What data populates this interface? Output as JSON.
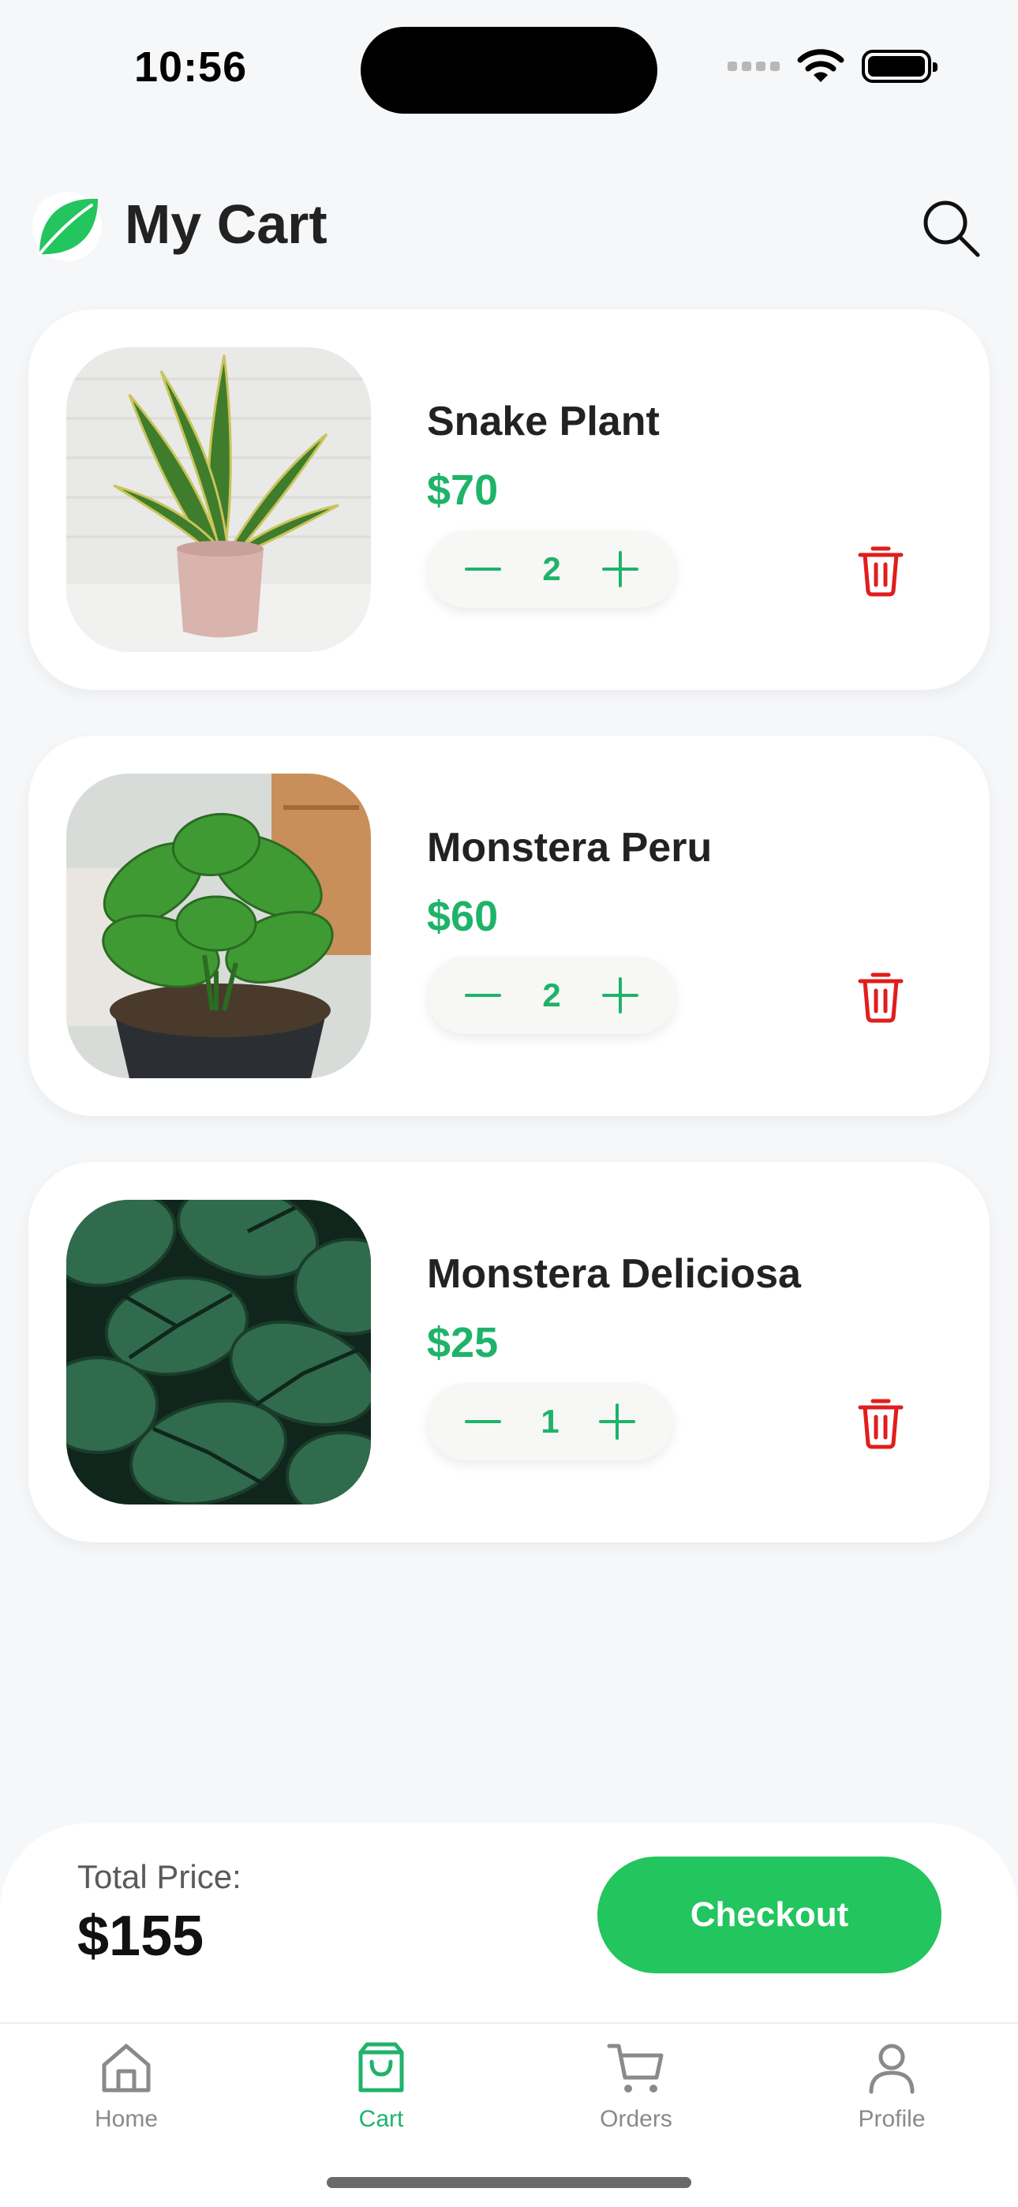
{
  "status_bar": {
    "time": "10:56"
  },
  "header": {
    "title": "My Cart"
  },
  "cart": {
    "items": [
      {
        "name": "Snake Plant",
        "price": "$70",
        "quantity": "2"
      },
      {
        "name": "Monstera Peru",
        "price": "$60",
        "quantity": "2"
      },
      {
        "name": "Monstera Deliciosa",
        "price": "$25",
        "quantity": "1"
      }
    ]
  },
  "summary": {
    "total_label": "Total Price:",
    "total_value": "$155",
    "checkout_label": "Checkout"
  },
  "tab_bar": {
    "tabs": [
      {
        "label": "Home",
        "icon": "home-icon",
        "active": false
      },
      {
        "label": "Cart",
        "icon": "shopping-bag-icon",
        "active": true
      },
      {
        "label": "Orders",
        "icon": "cart-icon",
        "active": false
      },
      {
        "label": "Profile",
        "icon": "user-icon",
        "active": false
      }
    ]
  },
  "colors": {
    "accent": "#22c55e",
    "price": "#1fb36a",
    "delete": "#e11d1d",
    "background": "#f6f7f9"
  }
}
